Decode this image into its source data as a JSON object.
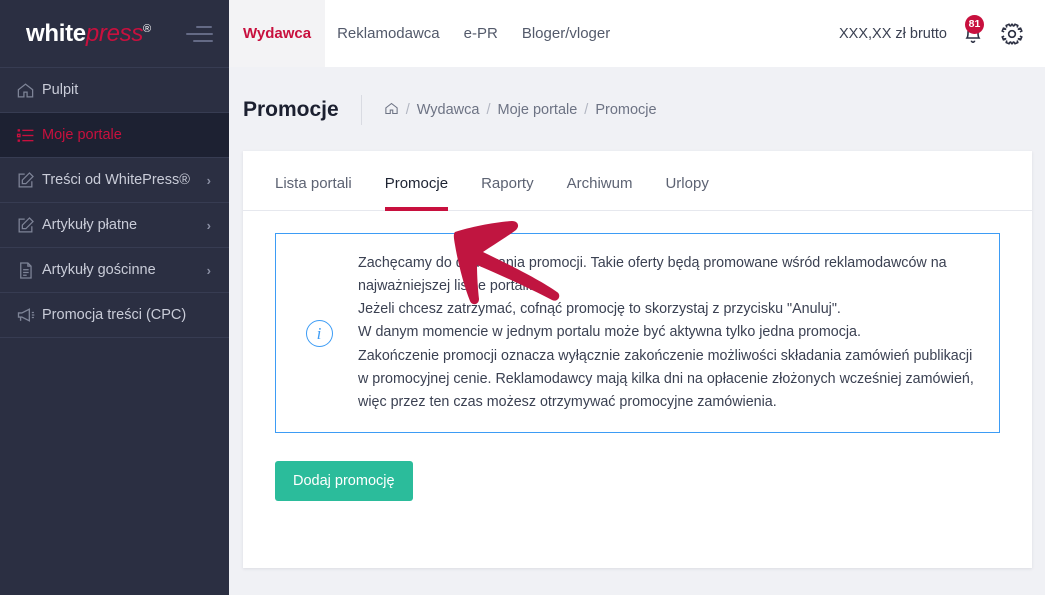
{
  "brand": {
    "part1": "white",
    "part2": "press",
    "registered": "®"
  },
  "sidebar": {
    "items": [
      {
        "label": "Pulpit",
        "icon": "home-icon",
        "active": false,
        "chevron": ""
      },
      {
        "label": "Moje portale",
        "icon": "list-icon",
        "active": true,
        "chevron": ""
      },
      {
        "label": "Treści od WhitePress®",
        "icon": "pencil-square-icon",
        "active": false,
        "chevron": "›"
      },
      {
        "label": "Artykuły płatne",
        "icon": "pencil-square-icon",
        "active": false,
        "chevron": "›"
      },
      {
        "label": "Artykuły gościnne",
        "icon": "document-icon",
        "active": false,
        "chevron": "›"
      },
      {
        "label": "Promocja treści (CPC)",
        "icon": "megaphone-icon",
        "active": false,
        "chevron": ""
      }
    ]
  },
  "topbar": {
    "tabs": [
      {
        "label": "Wydawca",
        "active": true
      },
      {
        "label": "Reklamodawca",
        "active": false
      },
      {
        "label": "e-PR",
        "active": false
      },
      {
        "label": "Bloger/vloger",
        "active": false
      }
    ],
    "balance": "XXX,XX zł brutto",
    "notification_count": "81",
    "bell_icon": "bell-icon",
    "settings_icon": "gear-icon"
  },
  "page": {
    "title": "Promocje",
    "breadcrumb": {
      "home_icon": "home-icon",
      "items": [
        "Wydawca",
        "Moje portale",
        "Promocje"
      ],
      "separator": "/"
    }
  },
  "card": {
    "tabs": [
      {
        "label": "Lista portali",
        "active": false
      },
      {
        "label": "Promocje",
        "active": true
      },
      {
        "label": "Raporty",
        "active": false
      },
      {
        "label": "Archiwum",
        "active": false
      },
      {
        "label": "Urlopy",
        "active": false
      }
    ],
    "info": {
      "icon": "info-circle-icon",
      "lines": [
        "Zachęcamy do dodawania promocji. Takie oferty będą promowane wśród reklamodawców na",
        "najważniejszej liście portali.",
        "Jeżeli chcesz zatrzymać, cofnąć promocję to skorzystaj z przycisku \"Anuluj\".",
        "W danym momencie w jednym portalu może być aktywna tylko jedna promocja.",
        "Zakończenie promocji oznacza wyłącznie zakończenie możliwości składania zamówień publikacji",
        "w promocyjnej cenie. Reklamodawcy mają kilka dni na opłacenie złożonych wcześniej zamówień,",
        "więc przez ten czas możesz otrzymywać promocyjne zamówienia."
      ]
    },
    "add_button": "Dodaj promocję"
  },
  "annotation": {
    "type": "arrow",
    "color": "#c01540",
    "points_to": "Promocje"
  },
  "colors": {
    "sidebar_bg": "#2b2f42",
    "sidebar_active_bg": "#1d2132",
    "accent_crimson": "#c8103e",
    "page_bg": "#f0f1f5",
    "info_blue": "#3d9cf5",
    "button_green": "#2bbc9b"
  }
}
